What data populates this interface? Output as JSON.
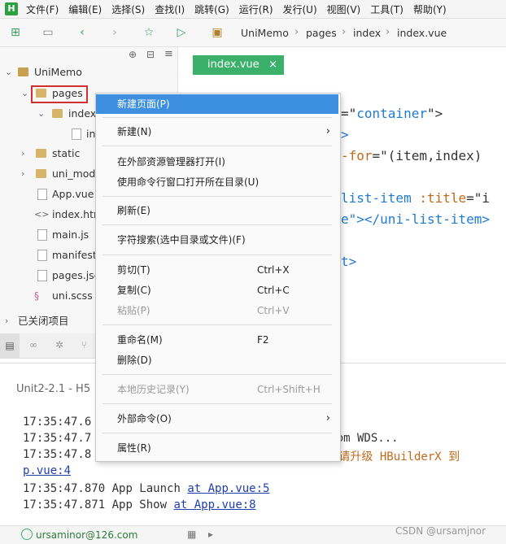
{
  "menubar": {
    "logo": "H",
    "items": [
      "文件(F)",
      "编辑(E)",
      "选择(S)",
      "查找(I)",
      "跳转(G)",
      "运行(R)",
      "发行(U)",
      "视图(V)",
      "工具(T)",
      "帮助(Y)"
    ]
  },
  "breadcrumb": [
    "UniMemo",
    "pages",
    "index",
    "index.vue"
  ],
  "tree": {
    "root": "UniMemo",
    "pages": "pages",
    "index_folder": "index",
    "index_file": "in",
    "static": "static",
    "uni_modules": "uni_mod",
    "app_vue": "App.vue",
    "index_html": "index.htm",
    "main_js": "main.js",
    "manifest": "manifest",
    "pages_json": "pages.jsc",
    "uni_scss": "uni.scss",
    "closed_projects": "已关闭项目"
  },
  "editor": {
    "tab_label": "index.vue",
    "tab_close": "×",
    "lines": [
      {
        "a": "=\"",
        "b": "container",
        "c": "\">"
      },
      {
        "a": ">",
        "b": "",
        "c": ""
      },
      {
        "a": "-for",
        "b": "=\"(item,index)",
        "c": ""
      },
      {
        "a": "list-item",
        "b": " :title",
        "c": "=\"i"
      },
      {
        "a": "e\">",
        "b": "</uni-list-item>",
        "c": ""
      },
      {
        "a": "t>",
        "b": "",
        "c": ""
      }
    ]
  },
  "panel": {
    "title": "Unit2-2.1 - H5",
    "logs": [
      {
        "time": "17:35:47.6",
        "text": "",
        "link": ""
      },
      {
        "time": "17:35:47.7",
        "text": "l from WDS...",
        "link": ""
      },
      {
        "time": "17:35:47.8",
        "text": "构 ，请升级 HBuilderX 到",
        "link": ""
      },
      {
        "time": "",
        "text": "",
        "link": "p.vue:4"
      },
      {
        "time": "17:35:47.870",
        "text": "App Launch",
        "link": "at App.vue:5"
      },
      {
        "time": "17:35:47.871",
        "text": "App Show",
        "link": "at App.vue:8"
      }
    ]
  },
  "status": {
    "user": "ursaminor@126.com",
    "watermark": "CSDN @ursamjnor"
  },
  "context_menu": {
    "items": [
      {
        "label": "新建页面(P)",
        "shortcut": "",
        "submenu": false,
        "disabled": false,
        "highlight": true
      },
      {
        "label": "新建(N)",
        "shortcut": "",
        "submenu": true,
        "disabled": false,
        "highlight": false
      },
      {
        "label": "在外部资源管理器打开(I)",
        "shortcut": "",
        "submenu": false,
        "disabled": false,
        "highlight": false
      },
      {
        "label": "使用命令行窗口打开所在目录(U)",
        "shortcut": "",
        "submenu": false,
        "disabled": false,
        "highlight": false
      },
      {
        "label": "刷新(E)",
        "shortcut": "",
        "submenu": false,
        "disabled": false,
        "highlight": false
      },
      {
        "label": "字符搜索(选中目录或文件)(F)",
        "shortcut": "",
        "submenu": false,
        "disabled": false,
        "highlight": false
      },
      {
        "label": "剪切(T)",
        "shortcut": "Ctrl+X",
        "submenu": false,
        "disabled": false,
        "highlight": false
      },
      {
        "label": "复制(C)",
        "shortcut": "Ctrl+C",
        "submenu": false,
        "disabled": false,
        "highlight": false
      },
      {
        "label": "粘贴(P)",
        "shortcut": "Ctrl+V",
        "submenu": false,
        "disabled": true,
        "highlight": false
      },
      {
        "label": "重命名(M)",
        "shortcut": "F2",
        "submenu": false,
        "disabled": false,
        "highlight": false
      },
      {
        "label": "删除(D)",
        "shortcut": "",
        "submenu": false,
        "disabled": false,
        "highlight": false
      },
      {
        "label": "本地历史记录(Y)",
        "shortcut": "Ctrl+Shift+H",
        "submenu": false,
        "disabled": true,
        "highlight": false
      },
      {
        "label": "外部命令(O)",
        "shortcut": "",
        "submenu": true,
        "disabled": false,
        "highlight": false
      },
      {
        "label": "属性(R)",
        "shortcut": "",
        "submenu": false,
        "disabled": false,
        "highlight": false
      }
    ]
  },
  "colors": {
    "accent": "#3ab06a",
    "highlight": "#3d8fe0",
    "annotation": "#d03030"
  }
}
